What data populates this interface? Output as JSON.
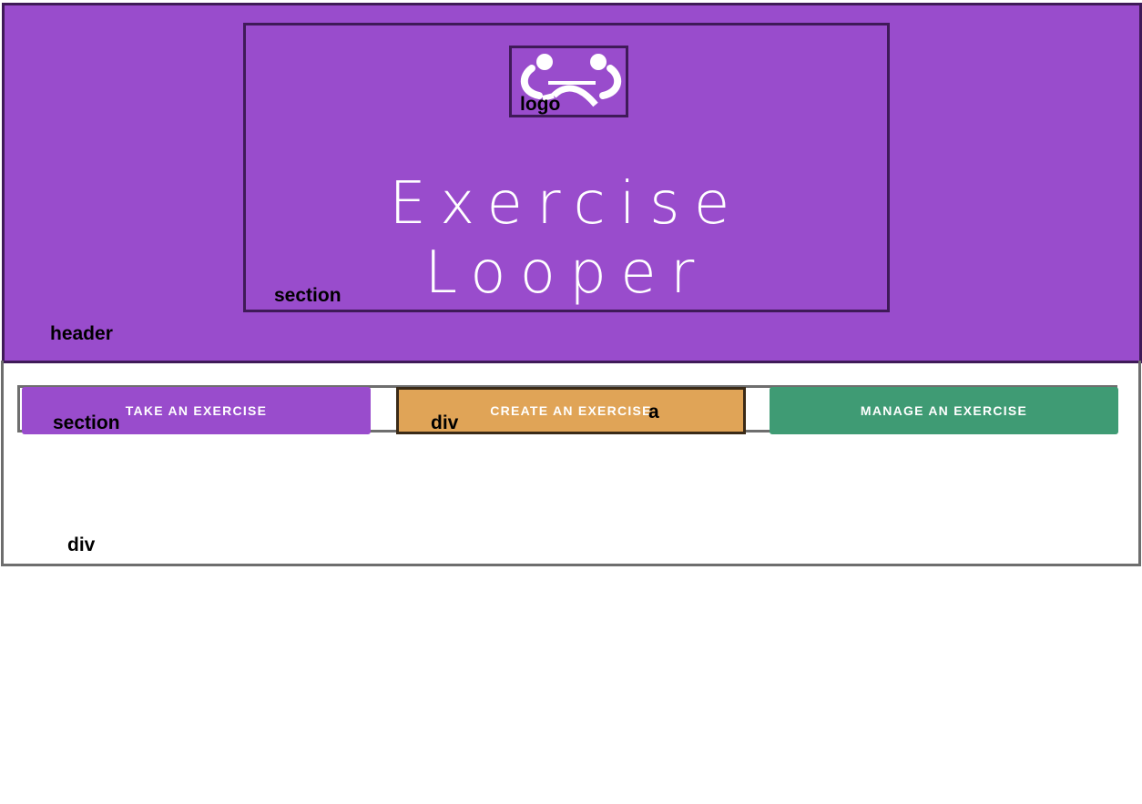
{
  "header": {
    "title_line1": "Exercise",
    "title_line2": "Looper",
    "logo_icon": "tug-of-war-icon",
    "labels": {
      "header": "header",
      "section": "section",
      "logo": "logo"
    }
  },
  "buttons": [
    {
      "label": "TAKE AN EXERCISE",
      "color": "#994ccc"
    },
    {
      "label": "CREATE AN EXERCISE",
      "color": "#e0a457"
    },
    {
      "label": "MANAGE AN EXERCISE",
      "color": "#3f9b74"
    }
  ],
  "main": {
    "labels": {
      "section": "section",
      "div": "div",
      "a": "a",
      "outer_div": "div"
    }
  },
  "colors": {
    "brand_purple": "#994ccc",
    "outline_dark": "#3f1a58",
    "create_orange": "#e0a457",
    "manage_green": "#3f9b74"
  }
}
